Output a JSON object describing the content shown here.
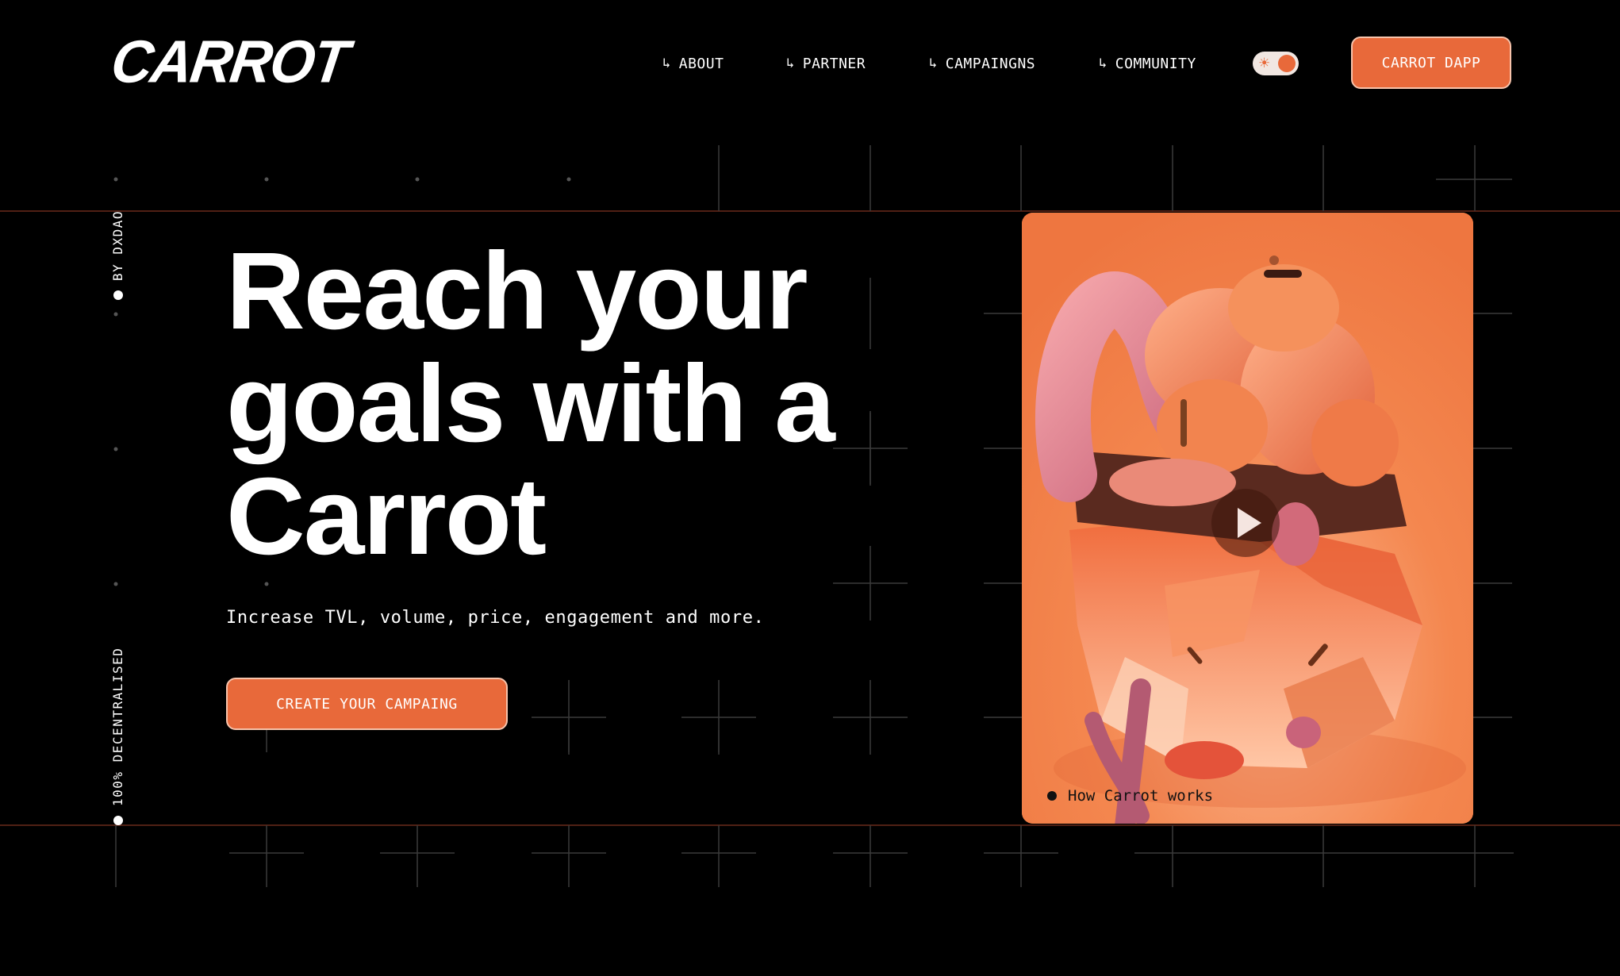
{
  "brand": {
    "logo_text": "CARROT"
  },
  "nav": {
    "arrow_glyph": "↳",
    "items": [
      {
        "label": "ABOUT"
      },
      {
        "label": "PARTNER"
      },
      {
        "label": "CAMPAINGNS"
      },
      {
        "label": "COMMUNITY"
      }
    ]
  },
  "theme_toggle": {
    "icon": "sun-icon",
    "glyph": "☀"
  },
  "header_cta": {
    "label": "CARROT DAPP"
  },
  "side_captions": {
    "top": "BY DXDAO",
    "bottom": "100% DECENTRALISED"
  },
  "hero": {
    "title_lines": [
      "Reach your",
      "goals with a",
      "Carrot"
    ],
    "subtitle": "Increase TVL, volume, price, engagement and more.",
    "cta_label": "CREATE YOUR CAMPAING"
  },
  "media_card": {
    "caption": "How Carrot works",
    "play_icon": "play-icon"
  },
  "colors": {
    "background": "#000000",
    "accent": "#e8693a",
    "accent_border": "#f7c3ab",
    "grid_line": "#3a3a3a",
    "guide_line": "#6b2a1a",
    "text": "#ffffff"
  }
}
